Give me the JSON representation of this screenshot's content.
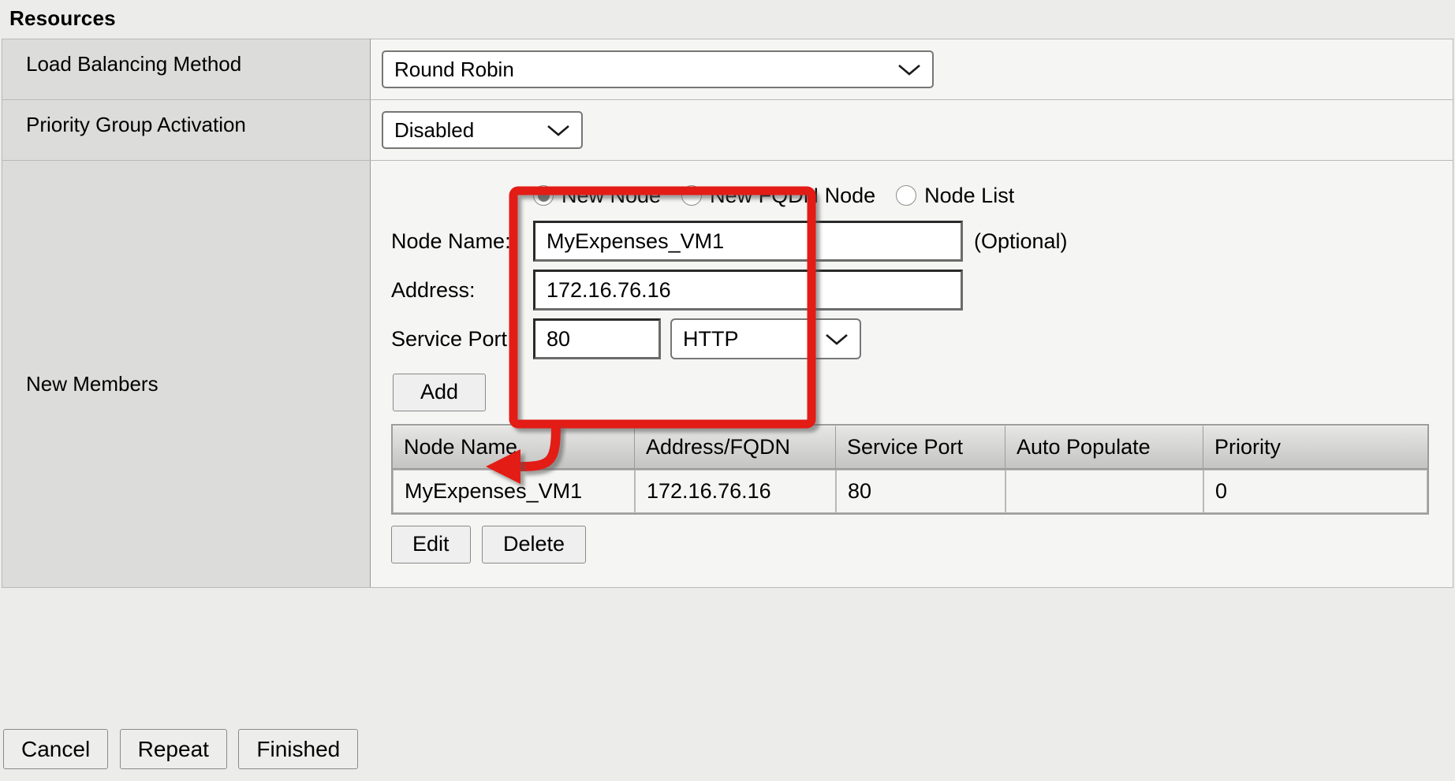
{
  "section": {
    "title": "Resources"
  },
  "rows": {
    "load_balancing": {
      "label": "Load Balancing Method",
      "value": "Round Robin",
      "chevron": "chevron-down-icon"
    },
    "priority_group": {
      "label": "Priority Group Activation",
      "value": "Disabled",
      "chevron": "chevron-down-icon"
    },
    "new_members": {
      "label": "New Members"
    }
  },
  "members": {
    "radios": [
      {
        "label": "New Node",
        "selected": true
      },
      {
        "label": "New FQDN Node",
        "selected": false
      },
      {
        "label": "Node List",
        "selected": false
      }
    ],
    "fields": {
      "node_name": {
        "label": "Node Name:",
        "value": "MyExpenses_VM1",
        "placeholder": "",
        "note": "(Optional)"
      },
      "address": {
        "label": "Address:",
        "value": "172.16.76.16",
        "placeholder": ""
      },
      "service_port": {
        "label": "Service Port:",
        "value": "80",
        "placeholder": "",
        "protocol": "HTTP",
        "protocol_chevron": "chevron-down-icon"
      }
    },
    "add_label": "Add",
    "table": {
      "headers": [
        "Node Name",
        "Address/FQDN",
        "Service Port",
        "Auto Populate",
        "Priority"
      ],
      "rows": [
        [
          "MyExpenses_VM1",
          "172.16.76.16",
          "80",
          "",
          "0"
        ]
      ]
    },
    "row_buttons": [
      {
        "label": "Edit"
      },
      {
        "label": "Delete"
      }
    ]
  },
  "footer": {
    "buttons": [
      {
        "label": "Cancel"
      },
      {
        "label": "Repeat"
      },
      {
        "label": "Finished"
      }
    ]
  },
  "annotation": {
    "highlight_color": "#e31b16",
    "shape": "rounded-rect-with-arrow"
  }
}
